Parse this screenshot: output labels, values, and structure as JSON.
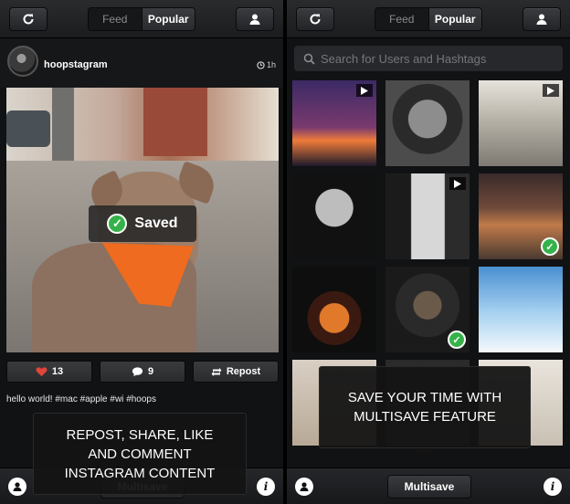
{
  "left": {
    "tabs": {
      "feed": "Feed",
      "popular": "Popular"
    },
    "post": {
      "username": "hoopstagram",
      "time": "1h",
      "likes": "13",
      "comments": "9",
      "repost_label": "Repost",
      "caption": "hello world! #mac #apple #wi",
      "caption_tail": "#hoops",
      "saved_label": "Saved"
    },
    "tooltip": "REPOST, SHARE, LIKE AND COMMENT INSTAGRAM CONTENT",
    "bottom_button": "Multisave"
  },
  "right": {
    "tabs": {
      "feed": "Feed",
      "popular": "Popular"
    },
    "search_placeholder": "Search for Users and Hashtags",
    "tooltip": "SAVE YOUR TIME WITH MULTISAVE FEATURE",
    "bottom_button": "Multisave",
    "tiles": [
      {
        "label": "lightning",
        "video": true,
        "saved": false
      },
      {
        "label": "portrait-bw",
        "video": false,
        "saved": false
      },
      {
        "label": "escalator-hall",
        "video": true,
        "saved": false
      },
      {
        "label": "woman-head-back",
        "video": false,
        "saved": false
      },
      {
        "label": "window-figure",
        "video": true,
        "saved": false
      },
      {
        "label": "misty-forest",
        "video": false,
        "saved": true
      },
      {
        "label": "whiskey-glass",
        "video": false,
        "saved": false
      },
      {
        "label": "hooded-man",
        "video": false,
        "saved": true
      },
      {
        "label": "white-dress",
        "video": false,
        "saved": false
      },
      {
        "label": "tile-10",
        "video": false,
        "saved": false
      },
      {
        "label": "tile-11",
        "video": false,
        "saved": false
      },
      {
        "label": "tile-12",
        "video": false,
        "saved": false
      }
    ]
  },
  "colors": {
    "accent_green": "#36b24a",
    "background": "#111213",
    "heart": "#e0453a"
  }
}
